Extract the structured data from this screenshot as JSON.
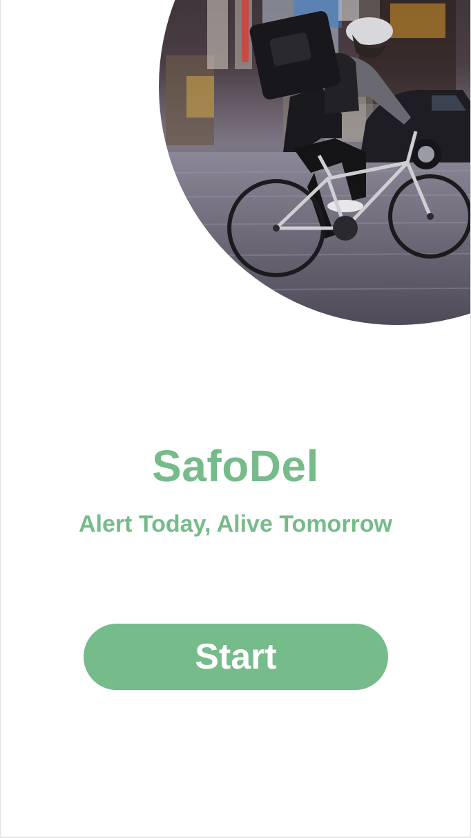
{
  "app": {
    "title": "SafoDel",
    "tagline": "Alert Today, Alive Tomorrow"
  },
  "actions": {
    "start_label": "Start"
  },
  "hero": {
    "icon": "cyclist-courier-photo"
  },
  "colors": {
    "brand_green": "#76BB8A",
    "background": "#FFFFFF"
  }
}
